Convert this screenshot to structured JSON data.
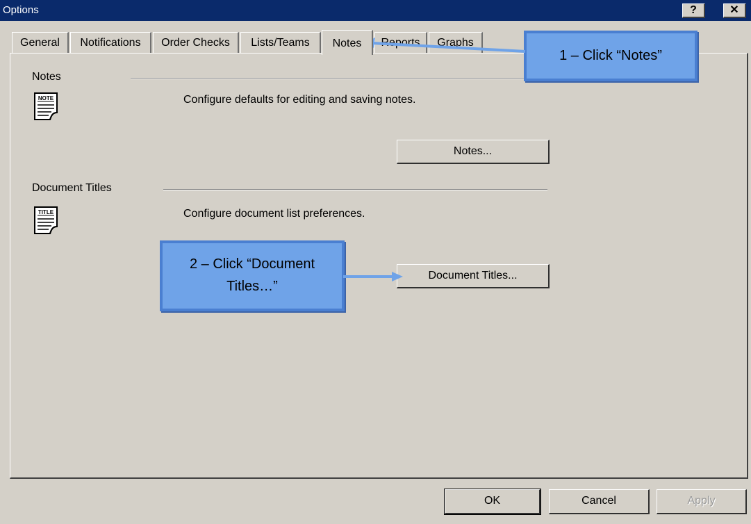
{
  "window": {
    "title": "Options",
    "help_label": "?",
    "close_label": "✕"
  },
  "tabs": [
    {
      "label": "General"
    },
    {
      "label": "Notifications"
    },
    {
      "label": "Order Checks"
    },
    {
      "label": "Lists/Teams"
    },
    {
      "label": "Notes",
      "active": true
    },
    {
      "label": "Reports"
    },
    {
      "label": "Graphs"
    }
  ],
  "notes_section": {
    "label": "Notes",
    "icon_text": "NOTE",
    "description": "Configure defaults for editing and saving notes.",
    "button_label": "Notes..."
  },
  "titles_section": {
    "label": "Document Titles",
    "icon_text": "TITLE",
    "description": "Configure document list preferences.",
    "button_label": "Document Titles..."
  },
  "callouts": {
    "step1": "1 – Click “Notes”",
    "step2_line1": "2 – Click “Document",
    "step2_line2": "Titles…”"
  },
  "footer": {
    "ok_label": "OK",
    "cancel_label": "Cancel",
    "apply_label": "Apply"
  },
  "colors": {
    "titlebar": "#0a2a6b",
    "callout_fill": "#6fa3e8",
    "callout_border": "#4a7fd1",
    "dialog_bg": "#d4d0c8"
  }
}
